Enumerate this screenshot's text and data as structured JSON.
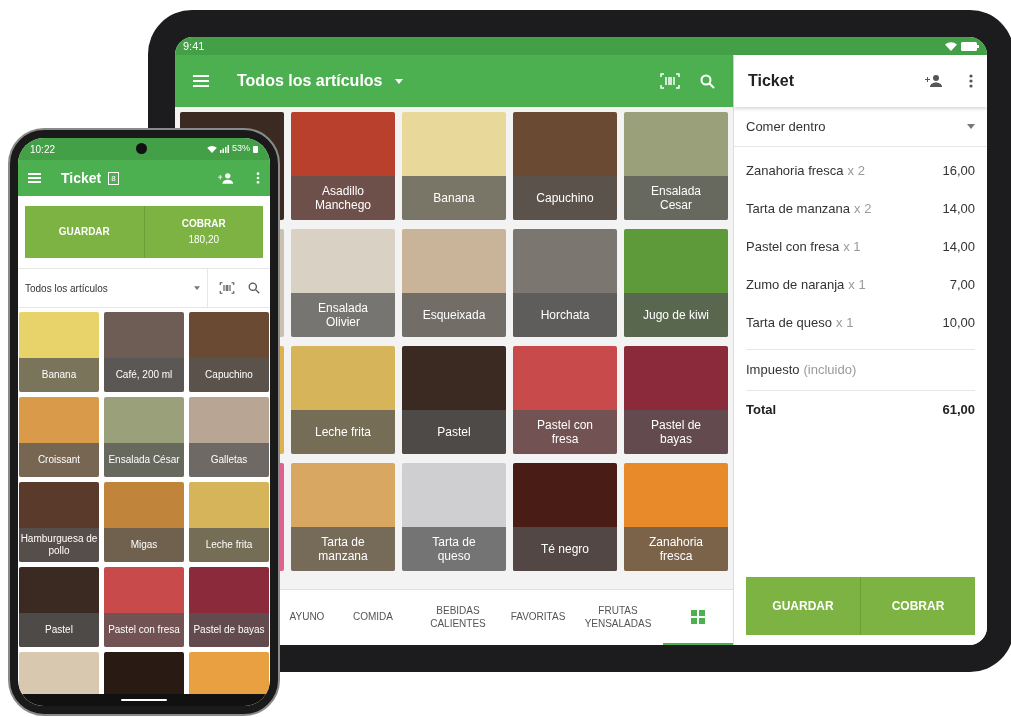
{
  "tablet": {
    "status_bar": {
      "time": "9:41"
    },
    "app_bar": {
      "title": "Todos los artículos"
    },
    "items": [
      {
        "label": "Asadillo Manchego"
      },
      {
        "label": "Banana"
      },
      {
        "label": "Capuchino"
      },
      {
        "label": "Ensalada Cesar"
      },
      {
        "label": "Ensalada Olivier"
      },
      {
        "label": "Esqueixada"
      },
      {
        "label": "Horchata"
      },
      {
        "label": "Jugo de kiwi"
      },
      {
        "label": "Leche frita"
      },
      {
        "label": "Pastel"
      },
      {
        "label": "Pastel con fresa"
      },
      {
        "label": "Pastel de bayas"
      },
      {
        "label": "Tarta de manzana"
      },
      {
        "label": "Tarta de queso"
      },
      {
        "label": "Té negro"
      },
      {
        "label": "Zanahoria fresca"
      }
    ],
    "category_tabs": [
      {
        "kind": "text",
        "label": "AYUNO",
        "selected": false
      },
      {
        "kind": "text",
        "label": "COMIDA",
        "selected": false
      },
      {
        "kind": "text",
        "label": "BEBIDAS CALIENTES",
        "selected": false
      },
      {
        "kind": "text",
        "label": "FAVORITAS",
        "selected": false
      },
      {
        "kind": "text",
        "label": "FRUTAS YENSALADAS",
        "selected": false
      },
      {
        "kind": "grid",
        "selected": true
      }
    ],
    "ticket": {
      "title": "Ticket",
      "dining_option": "Comer dentro",
      "lines": [
        {
          "name": "Zanahoria fresca",
          "quantity": "x 2",
          "amount": "16,00"
        },
        {
          "name": "Tarta de manzana",
          "quantity": "x 2",
          "amount": "14,00"
        },
        {
          "name": "Pastel con fresa",
          "quantity": "x 1",
          "amount": "14,00"
        },
        {
          "name": "Zumo de naranja",
          "quantity": "x 1",
          "amount": "7,00"
        },
        {
          "name": "Tarta de queso",
          "quantity": "x 1",
          "amount": "10,00"
        }
      ],
      "tax": {
        "label": "Impuesto",
        "note": "(incluido)"
      },
      "total": {
        "label": "Total",
        "amount": "61,00"
      },
      "buttons": [
        "GUARDAR",
        "COBRAR"
      ]
    }
  },
  "phone": {
    "status_bar": {
      "time": "10:22",
      "battery": "53%"
    },
    "app_bar": {
      "title": "Ticket",
      "badge": "8"
    },
    "buttons": [
      {
        "label": "GUARDAR"
      },
      {
        "label": "COBRAR",
        "amount": "180,20"
      }
    ],
    "category_filter": "Todos los artículos",
    "items": [
      {
        "label": "Banana"
      },
      {
        "label": "Café, 200 ml"
      },
      {
        "label": "Capuchino"
      },
      {
        "label": "Croissant"
      },
      {
        "label": "Ensalada César"
      },
      {
        "label": "Galletas"
      },
      {
        "label": "Hamburguesa de pollo"
      },
      {
        "label": "Migas"
      },
      {
        "label": "Leche frita"
      },
      {
        "label": "Pastel"
      },
      {
        "label": "Pastel con fresa"
      },
      {
        "label": "Pastel de bayas"
      }
    ]
  }
}
